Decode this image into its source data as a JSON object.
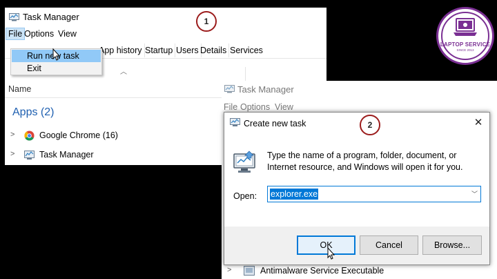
{
  "window1": {
    "title": "Task Manager",
    "menu": {
      "file": "File",
      "options": "Options",
      "view": "View"
    },
    "file_menu_items": {
      "run_new_task": "Run new task",
      "exit": "Exit"
    },
    "tabs": [
      "App history",
      "Startup",
      "Users",
      "Details",
      "Services"
    ],
    "column_name": "Name",
    "apps_heading": "Apps (2)",
    "processes": [
      {
        "name": "Google Chrome (16)",
        "icon": "chrome-icon"
      },
      {
        "name": "Task Manager",
        "icon": "task-manager-icon"
      }
    ]
  },
  "window2": {
    "title": "Task Manager",
    "menu": {
      "file": "File",
      "options": "Options",
      "view": "View"
    },
    "background_process": "Antimalware Service Executable"
  },
  "dialog": {
    "title": "Create new task",
    "close_glyph": "✕",
    "description": "Type the name of a program, folder, document, or Internet resource, and Windows will open it for you.",
    "open_label": "Open:",
    "open_value": "explorer.exe",
    "buttons": {
      "ok": "OK",
      "cancel": "Cancel",
      "browse": "Browse..."
    }
  },
  "badges": {
    "step1": "1",
    "step2": "2"
  },
  "logo": {
    "name": "LAPTOP SERVICE",
    "since": "SINCE 2013"
  },
  "colors": {
    "accent": "#0078d7",
    "badge_border": "#9b1b1b",
    "logo": "#7a2f93",
    "apps_heading": "#1e5fb0"
  }
}
